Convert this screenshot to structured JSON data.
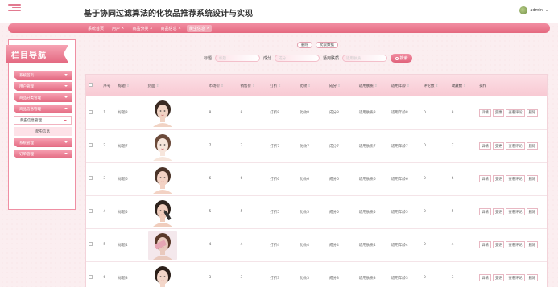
{
  "header": {
    "title": "基于协同过滤算法的化妆品推荐系统设计与实现",
    "user_name": "admin"
  },
  "tabs": [
    {
      "label": "系统首页",
      "closable": false,
      "active": false
    },
    {
      "label": "用户",
      "closable": true,
      "active": false
    },
    {
      "label": "商品分类",
      "closable": true,
      "active": false
    },
    {
      "label": "商品信息",
      "closable": true,
      "active": false
    },
    {
      "label": "爬虫信息",
      "closable": true,
      "active": true
    }
  ],
  "sidebar": {
    "title": "栏目导航",
    "items": [
      {
        "label": "系统首页",
        "open": false
      },
      {
        "label": "用户管理",
        "open": false
      },
      {
        "label": "商品分类管理",
        "open": false
      },
      {
        "label": "商品信息管理",
        "open": false
      },
      {
        "label": "爬虫信息管理",
        "open": true
      },
      {
        "label": "爬虫信息",
        "sub": true
      },
      {
        "label": "系统管理",
        "open": false
      },
      {
        "label": "订单管理",
        "open": false
      }
    ]
  },
  "actions": {
    "delete_label": "删除",
    "crawl_label": "爬取数据"
  },
  "search": {
    "fields": [
      {
        "label": "标题",
        "placeholder": "标题"
      },
      {
        "label": "成分",
        "placeholder": "成分"
      },
      {
        "label": "适用肤质",
        "placeholder": "适用肤质"
      }
    ],
    "button_label": "搜索"
  },
  "table": {
    "headers": [
      "序号",
      "标题",
      "封面",
      "市场价",
      "销售价",
      "打折",
      "功效",
      "成分",
      "适用肤质",
      "适用年龄",
      "评论数",
      "收藏数",
      "操作"
    ],
    "row_actions": [
      "详情",
      "变更",
      "查看评论",
      "删除"
    ],
    "rows": [
      {
        "idx": "1",
        "title": "标题8",
        "market": "8",
        "sale": "8",
        "discount": "打折8",
        "effect": "功效8",
        "ingredient": "成分8",
        "skin": "适用肤质8",
        "age": "适用年龄8",
        "comments": "0",
        "favs": "8",
        "img": "a"
      },
      {
        "idx": "2",
        "title": "标题7",
        "market": "7",
        "sale": "7",
        "discount": "打折7",
        "effect": "功效7",
        "ingredient": "成分7",
        "skin": "适用肤质7",
        "age": "适用年龄7",
        "comments": "0",
        "favs": "7",
        "img": "b"
      },
      {
        "idx": "3",
        "title": "标题6",
        "market": "6",
        "sale": "6",
        "discount": "打折6",
        "effect": "功效6",
        "ingredient": "成分6",
        "skin": "适用肤质6",
        "age": "适用年龄6",
        "comments": "0",
        "favs": "6",
        "img": "c"
      },
      {
        "idx": "4",
        "title": "标题5",
        "market": "5",
        "sale": "5",
        "discount": "打折5",
        "effect": "功效5",
        "ingredient": "成分5",
        "skin": "适用肤质5",
        "age": "适用年龄5",
        "comments": "0",
        "favs": "5",
        "img": "d"
      },
      {
        "idx": "5",
        "title": "标题4",
        "market": "4",
        "sale": "4",
        "discount": "打折4",
        "effect": "功效4",
        "ingredient": "成分4",
        "skin": "适用肤质4",
        "age": "适用年龄4",
        "comments": "0",
        "favs": "4",
        "img": "e"
      },
      {
        "idx": "6",
        "title": "标题3",
        "market": "3",
        "sale": "3",
        "discount": "打折3",
        "effect": "功效3",
        "ingredient": "成分3",
        "skin": "适用肤质3",
        "age": "适用年龄3",
        "comments": "0",
        "favs": "3",
        "img": "f"
      }
    ]
  },
  "colors": {
    "accent": "#e4687f",
    "accent_light": "#f7a2b3",
    "header_row": "#fbd3dc"
  }
}
